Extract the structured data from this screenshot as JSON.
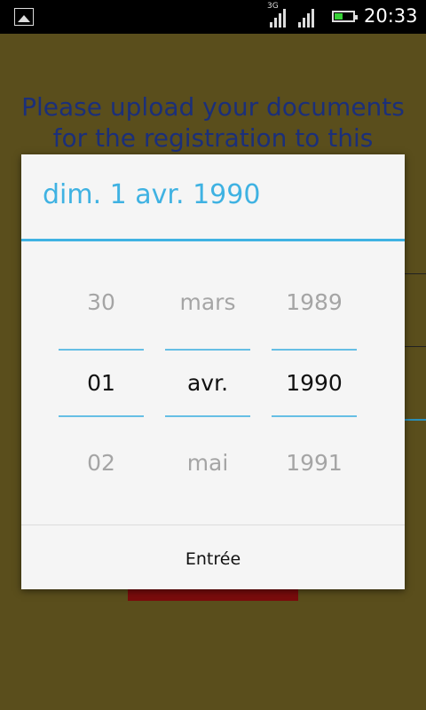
{
  "status_bar": {
    "network": "3G",
    "time": "20:33"
  },
  "background": {
    "heading_line1": "Please upload your documents",
    "heading_line2": "for the registration to this"
  },
  "date_picker": {
    "title": "dim. 1 avr. 1990",
    "day_column": {
      "prev": "30",
      "selected": "01",
      "next": "02"
    },
    "month_column": {
      "prev": "mars",
      "selected": "avr.",
      "next": "mai"
    },
    "year_column": {
      "prev": "1989",
      "selected": "1990",
      "next": "1991"
    },
    "confirm_label": "Entrée"
  },
  "colors": {
    "accent": "#3fb2e2",
    "background": "#5a4e1c",
    "heading": "#1b2f7a"
  }
}
